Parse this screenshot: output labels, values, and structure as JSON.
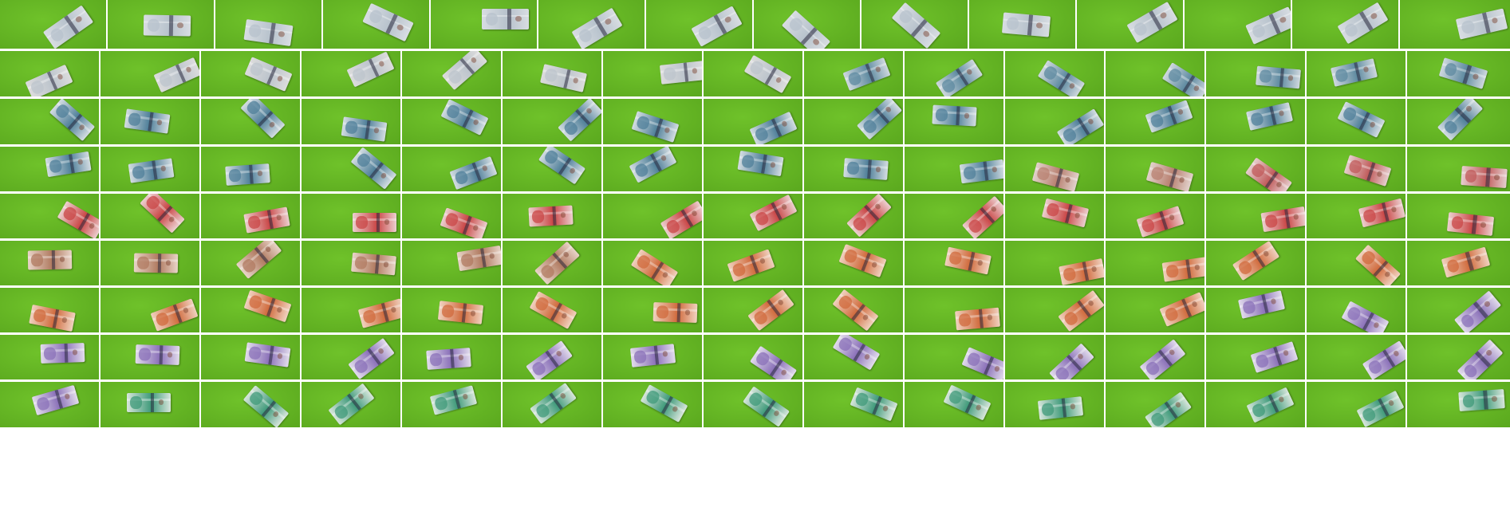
{
  "image": {
    "description_type": "photo-grid",
    "rows": [
      {
        "tiles": [
          {
            "t": "n",
            "c": [
              "#d8dde2",
              "#b7c2cc"
            ]
          },
          {
            "t": "n",
            "c": [
              "#d8dde2",
              "#b7c2cc"
            ]
          },
          {
            "t": "n",
            "c": [
              "#d8dde2",
              "#b7c2cc"
            ]
          },
          {
            "t": "n",
            "c": [
              "#d8dde2",
              "#b7c2cc"
            ]
          },
          {
            "t": "n",
            "c": [
              "#d8dde2",
              "#b7c2cc"
            ]
          },
          {
            "t": "n",
            "c": [
              "#d8dde2",
              "#b7c2cc"
            ]
          },
          {
            "t": "n",
            "c": [
              "#d8dde2",
              "#b7c2cc"
            ]
          },
          {
            "t": "n",
            "c": [
              "#d8dde2",
              "#b7c2cc"
            ]
          },
          {
            "t": "n",
            "c": [
              "#d8dde2",
              "#b7c2cc"
            ]
          },
          {
            "t": "n",
            "c": [
              "#d8dde2",
              "#b7c2cc"
            ]
          },
          {
            "t": "n",
            "c": [
              "#d8dde2",
              "#b7c2cc"
            ]
          },
          {
            "t": "n",
            "c": [
              "#d8dde2",
              "#b7c2cc"
            ]
          },
          {
            "t": "n",
            "c": [
              "#d8dde2",
              "#b7c2cc"
            ]
          },
          {
            "t": "n",
            "c": [
              "#d8dde2",
              "#b7c2cc"
            ]
          }
        ]
      },
      {
        "tiles": [
          {
            "t": "n",
            "c": [
              "#dcdcdc",
              "#bcc4cc"
            ]
          },
          {
            "t": "n",
            "c": [
              "#dcdcdc",
              "#bcc4cc"
            ]
          },
          {
            "t": "n",
            "c": [
              "#dcdcdc",
              "#bcc4cc"
            ]
          },
          {
            "t": "n",
            "c": [
              "#dcdcdc",
              "#bcc4cc"
            ]
          },
          {
            "t": "n",
            "c": [
              "#dcdcdc",
              "#bcc4cc"
            ]
          },
          {
            "t": "n",
            "c": [
              "#dcdcdc",
              "#bcc4cc"
            ]
          },
          {
            "t": "n",
            "c": [
              "#dcdcdc",
              "#bcc4cc"
            ]
          },
          {
            "t": "n",
            "c": [
              "#dcdcdc",
              "#bcc4cc"
            ]
          },
          {
            "t": "n",
            "c": [
              "#cfd8de",
              "#5e8aa0"
            ]
          },
          {
            "t": "n",
            "c": [
              "#cfd8de",
              "#5e8aa0"
            ]
          },
          {
            "t": "n",
            "c": [
              "#cfd8de",
              "#5e8aa0"
            ]
          },
          {
            "t": "n",
            "c": [
              "#cfd8de",
              "#5e8aa0"
            ]
          },
          {
            "t": "n",
            "c": [
              "#cfd8de",
              "#5e8aa0"
            ]
          },
          {
            "t": "n",
            "c": [
              "#cfd8de",
              "#5e8aa0"
            ]
          },
          {
            "t": "n",
            "c": [
              "#cfd8de",
              "#5e8aa0"
            ]
          }
        ]
      },
      {
        "tiles": [
          {
            "t": "n",
            "c": [
              "#d4dde2",
              "#4f7f99"
            ]
          },
          {
            "t": "n",
            "c": [
              "#d4dde2",
              "#4f7f99"
            ]
          },
          {
            "t": "n",
            "c": [
              "#d4dde2",
              "#4f7f99"
            ]
          },
          {
            "t": "n",
            "c": [
              "#d4dde2",
              "#4f7f99"
            ]
          },
          {
            "t": "n",
            "c": [
              "#d4dde2",
              "#4f7f99"
            ]
          },
          {
            "t": "n",
            "c": [
              "#d4dde2",
              "#4f7f99"
            ]
          },
          {
            "t": "n",
            "c": [
              "#d4dde2",
              "#4f7f99"
            ]
          },
          {
            "t": "n",
            "c": [
              "#d4dde2",
              "#4f7f99"
            ]
          },
          {
            "t": "n",
            "c": [
              "#d4dde2",
              "#4f7f99"
            ]
          },
          {
            "t": "n",
            "c": [
              "#d4dde2",
              "#4f7f99"
            ]
          },
          {
            "t": "n",
            "c": [
              "#d4dde2",
              "#4f7f99"
            ]
          },
          {
            "t": "n",
            "c": [
              "#d4dde2",
              "#4f7f99"
            ]
          },
          {
            "t": "n",
            "c": [
              "#d4dde2",
              "#4f7f99"
            ]
          },
          {
            "t": "n",
            "c": [
              "#d4dde2",
              "#4f7f99"
            ]
          },
          {
            "t": "n",
            "c": [
              "#d4dde2",
              "#4f7f99"
            ]
          }
        ]
      },
      {
        "tiles": [
          {
            "t": "n",
            "c": [
              "#d4dde2",
              "#4f7f99"
            ]
          },
          {
            "t": "n",
            "c": [
              "#d4dde2",
              "#4f7f99"
            ]
          },
          {
            "t": "n",
            "c": [
              "#d4dde2",
              "#4f7f99"
            ]
          },
          {
            "t": "n",
            "c": [
              "#d4dde2",
              "#4f7f99"
            ]
          },
          {
            "t": "n",
            "c": [
              "#d4dde2",
              "#4f7f99"
            ]
          },
          {
            "t": "n",
            "c": [
              "#d4dde2",
              "#4f7f99"
            ]
          },
          {
            "t": "n",
            "c": [
              "#d4dde2",
              "#4f7f99"
            ]
          },
          {
            "t": "n",
            "c": [
              "#d4dde2",
              "#4f7f99"
            ]
          },
          {
            "t": "n",
            "c": [
              "#d4dde2",
              "#4f7f99"
            ]
          },
          {
            "t": "n",
            "c": [
              "#d4dde2",
              "#4f7f99"
            ]
          },
          {
            "t": "n",
            "c": [
              "#e2d2cc",
              "#b88070"
            ]
          },
          {
            "t": "n",
            "c": [
              "#e2d2cc",
              "#b88070"
            ]
          },
          {
            "t": "n",
            "c": [
              "#e6cfcf",
              "#c05a5a"
            ]
          },
          {
            "t": "n",
            "c": [
              "#e6cfcf",
              "#c05a5a"
            ]
          },
          {
            "t": "n",
            "c": [
              "#e6cfcf",
              "#c05a5a"
            ]
          }
        ]
      },
      {
        "tiles": [
          {
            "t": "n",
            "c": [
              "#ecd0d0",
              "#c94545"
            ]
          },
          {
            "t": "n",
            "c": [
              "#ecd0d0",
              "#c94545"
            ]
          },
          {
            "t": "n",
            "c": [
              "#ecd0d0",
              "#c94545"
            ]
          },
          {
            "t": "n",
            "c": [
              "#ecd0d0",
              "#c94545"
            ]
          },
          {
            "t": "n",
            "c": [
              "#ecd0d0",
              "#c94545"
            ]
          },
          {
            "t": "n",
            "c": [
              "#ecd0d0",
              "#c94545"
            ]
          },
          {
            "t": "n",
            "c": [
              "#ecd0d0",
              "#c94545"
            ]
          },
          {
            "t": "n",
            "c": [
              "#ecd0d0",
              "#c94545"
            ]
          },
          {
            "t": "n",
            "c": [
              "#ecd0d0",
              "#c94545"
            ]
          },
          {
            "t": "n",
            "c": [
              "#ecd0d0",
              "#c94545"
            ]
          },
          {
            "t": "n",
            "c": [
              "#ecd0d0",
              "#c94545"
            ]
          },
          {
            "t": "n",
            "c": [
              "#ecd0d0",
              "#c94545"
            ]
          },
          {
            "t": "n",
            "c": [
              "#ecd0d0",
              "#c94545"
            ]
          },
          {
            "t": "n",
            "c": [
              "#ecd0d0",
              "#c94545"
            ]
          },
          {
            "t": "n",
            "c": [
              "#ecd0d0",
              "#c94545"
            ]
          }
        ]
      },
      {
        "tiles": [
          {
            "t": "n",
            "c": [
              "#e8d4c8",
              "#b07a60"
            ]
          },
          {
            "t": "n",
            "c": [
              "#e8d4c8",
              "#b07a60"
            ]
          },
          {
            "t": "n",
            "c": [
              "#e8d4c8",
              "#b07a60"
            ]
          },
          {
            "t": "n",
            "c": [
              "#e8d4c8",
              "#b07a60"
            ]
          },
          {
            "t": "n",
            "c": [
              "#e8d4c8",
              "#b07a60"
            ]
          },
          {
            "t": "n",
            "c": [
              "#e8d4c8",
              "#b07a60"
            ]
          },
          {
            "t": "n",
            "c": [
              "#f0d2c0",
              "#d06a3c"
            ]
          },
          {
            "t": "n",
            "c": [
              "#f0d2c0",
              "#d06a3c"
            ]
          },
          {
            "t": "n",
            "c": [
              "#f0d2c0",
              "#d06a3c"
            ]
          },
          {
            "t": "n",
            "c": [
              "#f0d2c0",
              "#d06a3c"
            ]
          },
          {
            "t": "n",
            "c": [
              "#f0d2c0",
              "#d06a3c"
            ]
          },
          {
            "t": "n",
            "c": [
              "#f0d2c0",
              "#d06a3c"
            ]
          },
          {
            "t": "n",
            "c": [
              "#f0d2c0",
              "#d06a3c"
            ]
          },
          {
            "t": "n",
            "c": [
              "#f0d2c0",
              "#d06a3c"
            ]
          },
          {
            "t": "n",
            "c": [
              "#f0d2c0",
              "#d06a3c"
            ]
          }
        ]
      },
      {
        "tiles": [
          {
            "t": "n",
            "c": [
              "#f0d2c0",
              "#d06a3c"
            ]
          },
          {
            "t": "n",
            "c": [
              "#f0d2c0",
              "#d06a3c"
            ]
          },
          {
            "t": "n",
            "c": [
              "#f0d2c0",
              "#d06a3c"
            ]
          },
          {
            "t": "n",
            "c": [
              "#f0d2c0",
              "#d06a3c"
            ]
          },
          {
            "t": "n",
            "c": [
              "#f0d2c0",
              "#d06a3c"
            ]
          },
          {
            "t": "n",
            "c": [
              "#f0d2c0",
              "#d06a3c"
            ]
          },
          {
            "t": "n",
            "c": [
              "#f0d2c0",
              "#d06a3c"
            ]
          },
          {
            "t": "n",
            "c": [
              "#f0d2c0",
              "#d06a3c"
            ]
          },
          {
            "t": "n",
            "c": [
              "#f0d2c0",
              "#d06a3c"
            ]
          },
          {
            "t": "n",
            "c": [
              "#f0d2c0",
              "#d06a3c"
            ]
          },
          {
            "t": "n",
            "c": [
              "#f0d2c0",
              "#d06a3c"
            ]
          },
          {
            "t": "n",
            "c": [
              "#f0d2c0",
              "#d06a3c"
            ]
          },
          {
            "t": "n",
            "c": [
              "#e2dcec",
              "#8a70b8"
            ]
          },
          {
            "t": "n",
            "c": [
              "#e2dcec",
              "#8a70b8"
            ]
          },
          {
            "t": "n",
            "c": [
              "#e2dcec",
              "#8a70b8"
            ]
          }
        ]
      },
      {
        "tiles": [
          {
            "t": "n",
            "c": [
              "#e2dcec",
              "#8a70b8"
            ]
          },
          {
            "t": "n",
            "c": [
              "#e2dcec",
              "#8a70b8"
            ]
          },
          {
            "t": "n",
            "c": [
              "#e2dcec",
              "#8a70b8"
            ]
          },
          {
            "t": "n",
            "c": [
              "#e2dcec",
              "#8a70b8"
            ]
          },
          {
            "t": "n",
            "c": [
              "#e2dcec",
              "#8a70b8"
            ]
          },
          {
            "t": "n",
            "c": [
              "#e2dcec",
              "#8a70b8"
            ]
          },
          {
            "t": "n",
            "c": [
              "#e2dcec",
              "#8a70b8"
            ]
          },
          {
            "t": "n",
            "c": [
              "#e2dcec",
              "#8a70b8"
            ]
          },
          {
            "t": "n",
            "c": [
              "#e2dcec",
              "#8a70b8"
            ]
          },
          {
            "t": "n",
            "c": [
              "#e2dcec",
              "#8a70b8"
            ]
          },
          {
            "t": "n",
            "c": [
              "#e2dcec",
              "#8a70b8"
            ]
          },
          {
            "t": "n",
            "c": [
              "#e2dcec",
              "#8a70b8"
            ]
          },
          {
            "t": "n",
            "c": [
              "#e2dcec",
              "#8a70b8"
            ]
          },
          {
            "t": "n",
            "c": [
              "#e2dcec",
              "#8a70b8"
            ]
          },
          {
            "t": "n",
            "c": [
              "#e2dcec",
              "#8a70b8"
            ]
          }
        ]
      },
      {
        "tiles": [
          {
            "t": "n",
            "c": [
              "#e2dcec",
              "#8a70b8"
            ]
          },
          {
            "t": "n",
            "c": [
              "#d8e6dc",
              "#3f9a7a"
            ]
          },
          {
            "t": "n",
            "c": [
              "#d8e6dc",
              "#3f9a7a"
            ]
          },
          {
            "t": "n",
            "c": [
              "#d8e6dc",
              "#3f9a7a"
            ]
          },
          {
            "t": "n",
            "c": [
              "#d8e6dc",
              "#3f9a7a"
            ]
          },
          {
            "t": "n",
            "c": [
              "#d8e6dc",
              "#3f9a7a"
            ]
          },
          {
            "t": "n",
            "c": [
              "#d8e6dc",
              "#3f9a7a"
            ]
          },
          {
            "t": "n",
            "c": [
              "#d8e6dc",
              "#3f9a7a"
            ]
          },
          {
            "t": "n",
            "c": [
              "#d8e6dc",
              "#3f9a7a"
            ]
          },
          {
            "t": "n",
            "c": [
              "#d8e6dc",
              "#3f9a7a"
            ]
          },
          {
            "t": "n",
            "c": [
              "#d8e6dc",
              "#3f9a7a"
            ]
          },
          {
            "t": "n",
            "c": [
              "#d8e6dc",
              "#3f9a7a"
            ]
          },
          {
            "t": "n",
            "c": [
              "#d8e6dc",
              "#3f9a7a"
            ]
          },
          {
            "t": "n",
            "c": [
              "#d8e6dc",
              "#3f9a7a"
            ]
          },
          {
            "t": "n",
            "c": [
              "#d8e6dc",
              "#3f9a7a"
            ]
          }
        ]
      }
    ],
    "background_green": [
      "#6fc22a",
      "#5aa81e"
    ]
  }
}
